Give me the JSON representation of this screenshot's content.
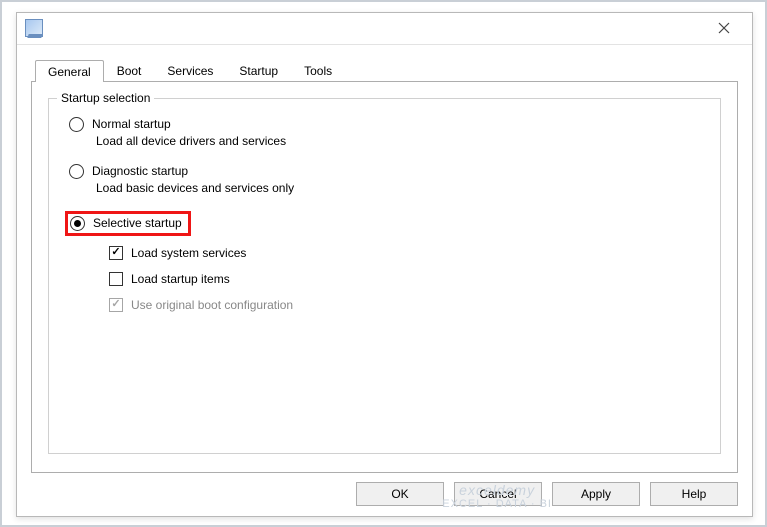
{
  "tabs": {
    "general": "General",
    "boot": "Boot",
    "services": "Services",
    "startup": "Startup",
    "tools": "Tools"
  },
  "group": {
    "title": "Startup selection"
  },
  "opt_normal": {
    "label": "Normal startup",
    "desc": "Load all device drivers and services"
  },
  "opt_diag": {
    "label": "Diagnostic startup",
    "desc": "Load basic devices and services only"
  },
  "opt_selective": {
    "label": "Selective startup"
  },
  "chk_sys": {
    "label": "Load system services"
  },
  "chk_startup": {
    "label": "Load startup items"
  },
  "chk_boot": {
    "label": "Use original boot configuration"
  },
  "buttons": {
    "ok": "OK",
    "cancel": "Cancel",
    "apply": "Apply",
    "help": "Help"
  },
  "watermark": {
    "top": "exceldemy",
    "sub": "EXCEL · DATA · BI"
  }
}
